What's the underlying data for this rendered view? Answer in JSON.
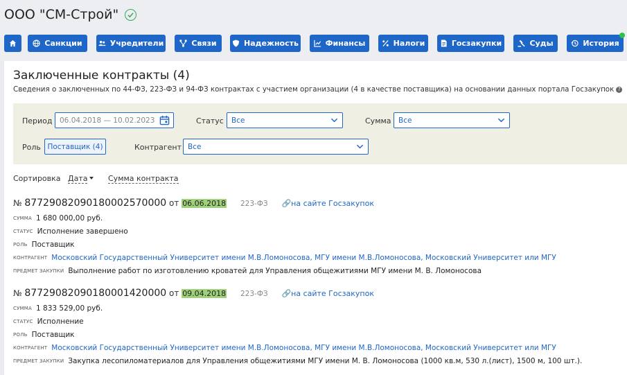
{
  "company": {
    "name": "ООО \"СМ-Строй\"",
    "verified_icon": "check-circle-icon",
    "status_color": "#3aa757"
  },
  "nav": [
    {
      "label": "",
      "icon": "home-icon"
    },
    {
      "label": "Санкции",
      "icon": "globe-icon"
    },
    {
      "label": "Учредители",
      "icon": "users-icon"
    },
    {
      "label": "Связи",
      "icon": "network-icon"
    },
    {
      "label": "Надежность",
      "icon": "shield-icon"
    },
    {
      "label": "Финансы",
      "icon": "chart-icon"
    },
    {
      "label": "Налоги",
      "icon": "percent-icon"
    },
    {
      "label": "Госзакупки",
      "icon": "document-icon"
    },
    {
      "label": "Суды",
      "icon": "gavel-icon"
    },
    {
      "label": "История",
      "icon": "history-icon"
    }
  ],
  "accent_color": "#1f66c9",
  "section": {
    "title": "Заключенные контракты (4)",
    "subtitle": "Сведения о заключенных по 44-ФЗ, 223-ФЗ и 94-ФЗ контрактах с участием организации (4 в качестве поставщика) на основании данных портала Госзакупок"
  },
  "filters": {
    "period_label": "Период",
    "period_value": "06.04.2018 — 10.02.2023",
    "status_label": "Статус",
    "status_value": "Все",
    "sum_label": "Сумма",
    "sum_value": "Все",
    "role_label": "Роль",
    "role_value": "Поставщик (4)",
    "counterparty_label": "Контрагент",
    "counterparty_value": "Все"
  },
  "sort": {
    "label": "Сортировка",
    "by_date": "Дата",
    "by_sum": "Сумма контракта"
  },
  "contracts": [
    {
      "no_prefix": "№",
      "number": "87729082090180002570000",
      "from": "от",
      "date": "06.06.2018",
      "law": "223-ФЗ",
      "link": "на сайте Госзакупок",
      "sum_key": "сумма",
      "sum": "1 680 000,00 руб.",
      "status_key": "статус",
      "status": "Исполнение завершено",
      "role_key": "роль",
      "role": "Поставщик",
      "cp_key": "контрагент",
      "counterparty": "Московский Государственный Университет имени М.В.Ломоносова, МГУ имени М.В.Ломоносова, Московский Университет или МГУ",
      "subj_key": "предмет закупки",
      "subject": "Выполнение работ по изготовлению кроватей для Управления общежитиями МГУ имени М. В. Ломоносова"
    },
    {
      "no_prefix": "№",
      "number": "87729082090180001420000",
      "from": "от",
      "date": "09.04.2018",
      "law": "223-ФЗ",
      "link": "на сайте Госзакупок",
      "sum_key": "сумма",
      "sum": "1 833 529,00 руб.",
      "status_key": "статус",
      "status": "Исполнение",
      "role_key": "роль",
      "role": "Поставщик",
      "cp_key": "контрагент",
      "counterparty": "Московский Государственный Университет имени М.В.Ломоносова, МГУ имени М.В.Ломоносова, Московский Университет или МГУ",
      "subj_key": "предмет закупки",
      "subject": "Закупка лесопиломатериалов для Управления общежитиями МГУ имени М. В. Ломоносова (1000 кв.м, 530 л.(лист), 1500 м, 100 шт.)."
    }
  ]
}
